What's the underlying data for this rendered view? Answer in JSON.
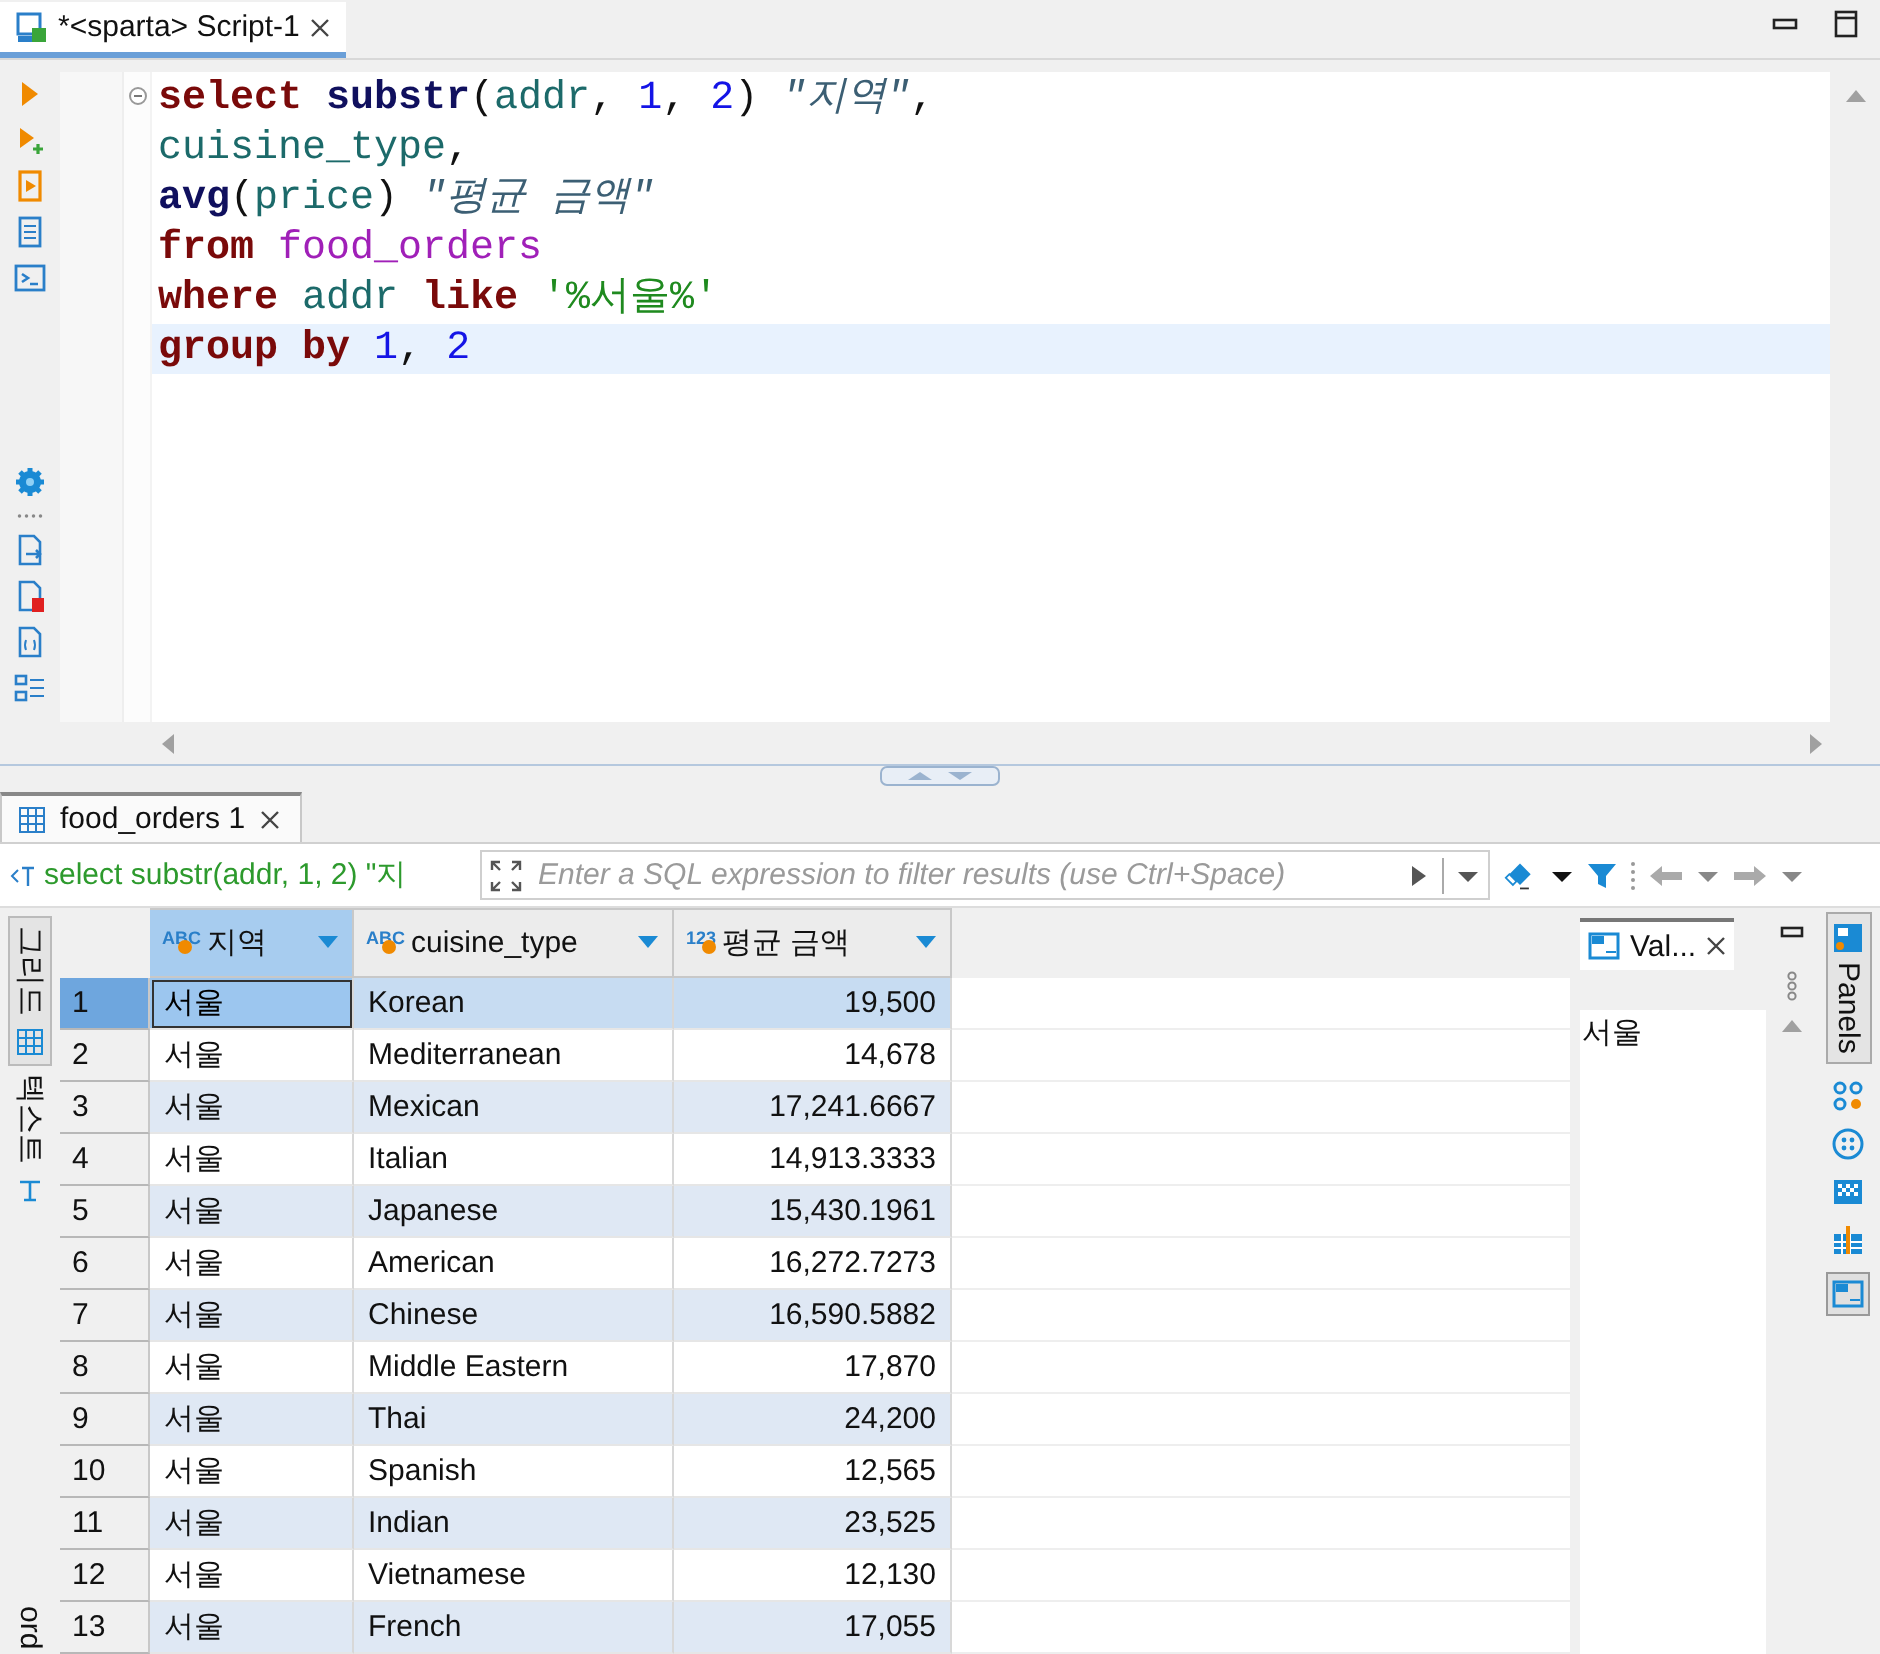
{
  "editor_tab": {
    "title": "*<sparta> Script-1",
    "selected": true
  },
  "code_lines": [
    {
      "highlighted": false,
      "tokens": [
        {
          "kind": "keyword",
          "text": "select "
        },
        {
          "kind": "func",
          "text": "substr"
        },
        {
          "kind": "plain",
          "text": "("
        },
        {
          "kind": "ident",
          "text": "addr"
        },
        {
          "kind": "plain",
          "text": ", "
        },
        {
          "kind": "number",
          "text": "1"
        },
        {
          "kind": "plain",
          "text": ", "
        },
        {
          "kind": "number",
          "text": "2"
        },
        {
          "kind": "plain",
          "text": ") "
        },
        {
          "kind": "alias",
          "text": "\"지역\""
        },
        {
          "kind": "plain",
          "text": ","
        }
      ]
    },
    {
      "highlighted": false,
      "tokens": [
        {
          "kind": "ident",
          "text": "cuisine_type"
        },
        {
          "kind": "plain",
          "text": ","
        }
      ]
    },
    {
      "highlighted": false,
      "tokens": [
        {
          "kind": "func",
          "text": "avg"
        },
        {
          "kind": "plain",
          "text": "("
        },
        {
          "kind": "ident",
          "text": "price"
        },
        {
          "kind": "plain",
          "text": ") "
        },
        {
          "kind": "alias",
          "text": "\"평균 금액\""
        }
      ]
    },
    {
      "highlighted": false,
      "tokens": [
        {
          "kind": "keyword",
          "text": "from "
        },
        {
          "kind": "table",
          "text": "food_orders"
        }
      ]
    },
    {
      "highlighted": false,
      "tokens": [
        {
          "kind": "keyword",
          "text": "where "
        },
        {
          "kind": "ident",
          "text": "addr "
        },
        {
          "kind": "keyword",
          "text": "like "
        },
        {
          "kind": "string",
          "text": "'%서울%'"
        }
      ]
    },
    {
      "highlighted": true,
      "tokens": [
        {
          "kind": "keyword",
          "text": "group by "
        },
        {
          "kind": "number",
          "text": "1"
        },
        {
          "kind": "plain",
          "text": ", "
        },
        {
          "kind": "number",
          "text": "2"
        }
      ]
    }
  ],
  "results_tab": {
    "title": "food_orders 1",
    "selected": true
  },
  "filter": {
    "query": "select substr(addr, 1, 2) \"지",
    "placeholder": "Enter a SQL expression to filter results (use Ctrl+Space)"
  },
  "view_tabs": [
    {
      "label": "그리드",
      "selected": true
    },
    {
      "label": "텍스트",
      "selected": false
    }
  ],
  "record_tab": {
    "label": "ord"
  },
  "columns": [
    {
      "type_badge": "ABC",
      "label": "지역",
      "selected": true
    },
    {
      "type_badge": "ABC",
      "label": "cuisine_type",
      "selected": false
    },
    {
      "type_badge": "123",
      "label": "평균 금액",
      "selected": false
    }
  ],
  "rows": [
    {
      "num": "1",
      "selected": true,
      "cells": [
        "서울",
        "Korean",
        "19,500"
      ]
    },
    {
      "num": "2",
      "selected": false,
      "cells": [
        "서울",
        "Mediterranean",
        "14,678"
      ]
    },
    {
      "num": "3",
      "selected": false,
      "cells": [
        "서울",
        "Mexican",
        "17,241.6667"
      ]
    },
    {
      "num": "4",
      "selected": false,
      "cells": [
        "서울",
        "Italian",
        "14,913.3333"
      ]
    },
    {
      "num": "5",
      "selected": false,
      "cells": [
        "서울",
        "Japanese",
        "15,430.1961"
      ]
    },
    {
      "num": "6",
      "selected": false,
      "cells": [
        "서울",
        "American",
        "16,272.7273"
      ]
    },
    {
      "num": "7",
      "selected": false,
      "cells": [
        "서울",
        "Chinese",
        "16,590.5882"
      ]
    },
    {
      "num": "8",
      "selected": false,
      "cells": [
        "서울",
        "Middle Eastern",
        "17,870"
      ]
    },
    {
      "num": "9",
      "selected": false,
      "cells": [
        "서울",
        "Thai",
        "24,200"
      ]
    },
    {
      "num": "10",
      "selected": false,
      "cells": [
        "서울",
        "Spanish",
        "12,565"
      ]
    },
    {
      "num": "11",
      "selected": false,
      "cells": [
        "서울",
        "Indian",
        "23,525"
      ]
    },
    {
      "num": "12",
      "selected": false,
      "cells": [
        "서울",
        "Vietnamese",
        "12,130"
      ]
    },
    {
      "num": "13",
      "selected": false,
      "cells": [
        "서울",
        "French",
        "17,055"
      ]
    }
  ],
  "value_panel": {
    "tab": "Val...",
    "value": "서울"
  },
  "panels_tab": {
    "label": "Panels",
    "selected": true
  }
}
